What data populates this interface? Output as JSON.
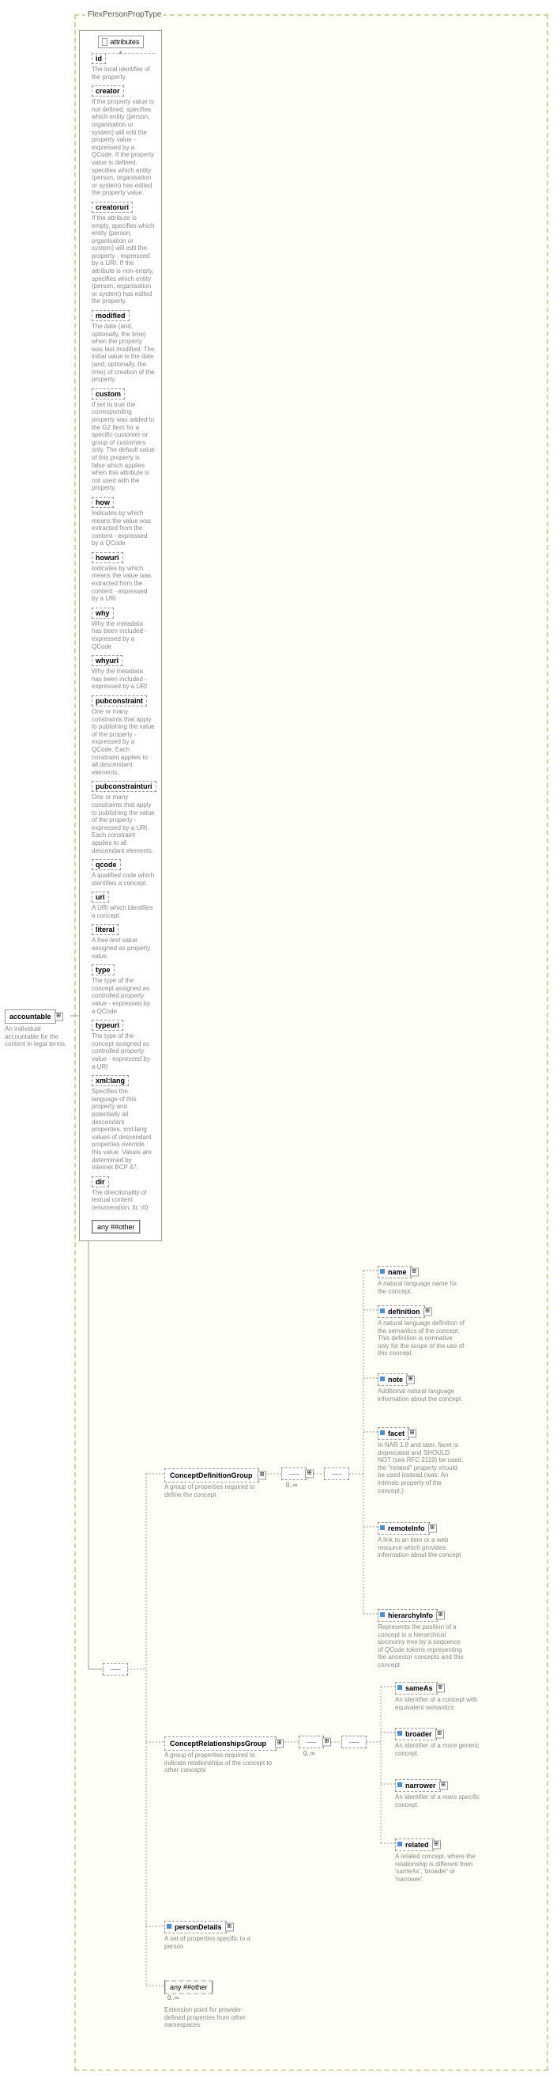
{
  "title": "FlexPersonPropType",
  "root": {
    "name": "accountable",
    "desc": "An individual accountable for the content in legal terms."
  },
  "attrHeader": "attributes",
  "attributes": [
    {
      "name": "id",
      "desc": "The local identifier of the property."
    },
    {
      "name": "creator",
      "desc": "If the property value is not defined, specifies which entity (person, organisation or system) will edit the property value - expressed by a QCode. If the property value is defined, specifies which entity (person, organisation or system) has edited the property value."
    },
    {
      "name": "creatoruri",
      "desc": "If the attribute is empty, specifies which entity (person, organisation or system) will edit the property - expressed by a URI. If the attribute is non-empty, specifies which entity (person, organisation or system) has edited the property."
    },
    {
      "name": "modified",
      "desc": "The date (and, optionally, the time) when the property was last modified. The initial value is the date (and, optionally, the time) of creation of the property."
    },
    {
      "name": "custom",
      "desc": "If set to true the corresponding property was added to the G2 Item for a specific customer or group of customers only. The default value of this property is false which applies when this attribute is not used with the property."
    },
    {
      "name": "how",
      "desc": "Indicates by which means the value was extracted from the content - expressed by a QCode"
    },
    {
      "name": "howuri",
      "desc": "Indicates by which means the value was extracted from the content - expressed by a URI"
    },
    {
      "name": "why",
      "desc": "Why the metadata has been included - expressed by a QCode"
    },
    {
      "name": "whyuri",
      "desc": "Why the metadata has been included - expressed by a URI"
    },
    {
      "name": "pubconstraint",
      "desc": "One or many constraints that apply to publishing the value of the property - expressed by a QCode. Each constraint applies to all descendant elements."
    },
    {
      "name": "pubconstrainturi",
      "desc": "One or many constraints that apply to publishing the value of the property - expressed by a URI. Each constraint applies to all descendant elements."
    },
    {
      "name": "qcode",
      "desc": "A qualified code which identifies a concept."
    },
    {
      "name": "uri",
      "desc": "A URI which identifies a concept."
    },
    {
      "name": "literal",
      "desc": "A free-text value assigned as property value."
    },
    {
      "name": "type",
      "desc": "The type of the concept assigned as controlled property value - expressed by a QCode"
    },
    {
      "name": "typeuri",
      "desc": "The type of the concept assigned as controlled property value - expressed by a URI"
    },
    {
      "name": "xml:lang",
      "desc": "Specifies the language of this property and potentially all descendant properties. xml:lang values of descendant properties override this value. Values are determined by Internet BCP 47."
    },
    {
      "name": "dir",
      "desc": "The directionality of textual content (enumeration: ltr, rtl)"
    }
  ],
  "anyOther": "any ##other",
  "groups": {
    "cdg": {
      "name": "ConceptDefinitionGroup",
      "desc": "A group of properties required to define the concept"
    },
    "crg": {
      "name": "ConceptRelationshipsGroup",
      "desc": "A group of properties required to indicate relationships of the concept to other concepts"
    }
  },
  "cdgChildren": [
    {
      "name": "name",
      "desc": "A natural language name for the concept."
    },
    {
      "name": "definition",
      "desc": "A natural language definition of the semantics of the concept. This definition is normative only for the scope of the use of this concept."
    },
    {
      "name": "note",
      "desc": "Additional natural language information about the concept."
    },
    {
      "name": "facet",
      "desc": "In NAR 1.8 and later, facet is deprecated and SHOULD NOT (see RFC 2119) be used, the \"related\" property should be used instead.(was: An intrinsic property of the concept.)"
    },
    {
      "name": "remoteInfo",
      "desc": "A link to an item or a web resource which provides information about the concept"
    },
    {
      "name": "hierarchyInfo",
      "desc": "Represents the position of a concept in a hierarchical taxonomy tree by a sequence of QCode tokens representing the ancestor concepts and this concept"
    }
  ],
  "crgChildren": [
    {
      "name": "sameAs",
      "desc": "An identifier of a concept with equivalent semantics"
    },
    {
      "name": "broader",
      "desc": "An identifier of a more generic concept."
    },
    {
      "name": "narrower",
      "desc": "An identifier of a more specific concept."
    },
    {
      "name": "related",
      "desc": "A related concept, where the relationship is different from 'sameAs', 'broader' or 'narrower'."
    }
  ],
  "personDetails": {
    "name": "personDetails",
    "desc": "A set of properties specific to a person"
  },
  "anyExt": {
    "label": "any ##other",
    "desc": "Extension point for provider-defined properties from other namespaces"
  },
  "range": "0..∞"
}
